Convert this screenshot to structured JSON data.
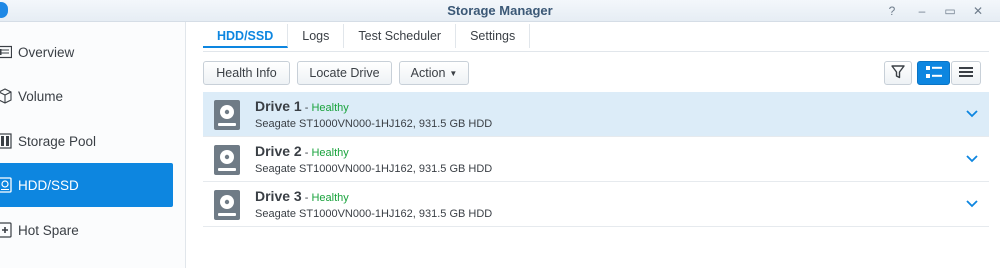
{
  "window": {
    "title": "Storage Manager",
    "help_icon": "?",
    "minimize_icon": "–",
    "maximize_icon": "▭",
    "close_icon": "✕"
  },
  "sidebar": {
    "items": [
      {
        "label": "Overview",
        "icon": "overview-icon",
        "active": false
      },
      {
        "label": "Volume",
        "icon": "volume-icon",
        "active": false
      },
      {
        "label": "Storage Pool",
        "icon": "storage-pool-icon",
        "active": false
      },
      {
        "label": "HDD/SSD",
        "icon": "hdd-icon",
        "active": true
      },
      {
        "label": "Hot Spare",
        "icon": "hot-spare-icon",
        "active": false
      }
    ]
  },
  "tabs": [
    {
      "label": "HDD/SSD",
      "active": true
    },
    {
      "label": "Logs",
      "active": false
    },
    {
      "label": "Test Scheduler",
      "active": false
    },
    {
      "label": "Settings",
      "active": false
    }
  ],
  "toolbar": {
    "health_info": "Health Info",
    "locate_drive": "Locate Drive",
    "action": "Action",
    "filter_icon": "filter-icon",
    "view_detail_icon": "detail-view-icon",
    "view_list_icon": "list-view-icon"
  },
  "drives": [
    {
      "name": "Drive 1",
      "separator": " - ",
      "status": "Healthy",
      "model": "Seagate ST1000VN000-1HJ162, 931.5 GB HDD",
      "selected": true
    },
    {
      "name": "Drive 2",
      "separator": " - ",
      "status": "Healthy",
      "model": "Seagate ST1000VN000-1HJ162, 931.5 GB HDD",
      "selected": false
    },
    {
      "name": "Drive 3",
      "separator": " - ",
      "status": "Healthy",
      "model": "Seagate ST1000VN000-1HJ162, 931.5 GB HDD",
      "selected": false
    }
  ],
  "colors": {
    "accent": "#0d86e0",
    "healthy": "#1aa33d",
    "selected_row": "#dcecf8"
  }
}
